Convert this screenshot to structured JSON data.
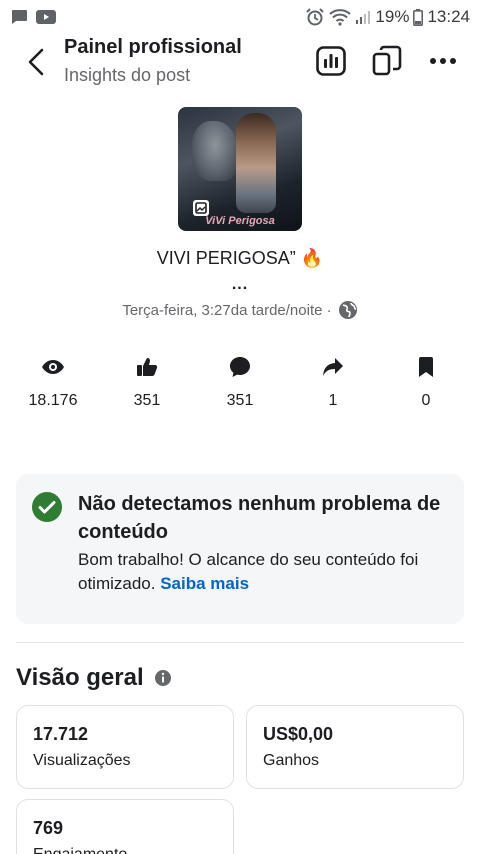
{
  "status_bar": {
    "battery": "19%",
    "time": "13:24"
  },
  "header": {
    "title": "Painel profissional",
    "subtitle": "Insights do post"
  },
  "post": {
    "thumbnail_caption": "ViVi Perigosa",
    "title": "VIVI PERIGOSA” 🔥",
    "more": "...",
    "timestamp": "Terça-feira, 3:27da tarde/noite ·"
  },
  "stats": [
    {
      "icon": "eye-icon",
      "value": "18.176"
    },
    {
      "icon": "thumbs-up-icon",
      "value": "351"
    },
    {
      "icon": "comment-icon",
      "value": "351"
    },
    {
      "icon": "share-icon",
      "value": "1"
    },
    {
      "icon": "bookmark-icon",
      "value": "0"
    }
  ],
  "notice": {
    "title": "Não detectamos nenhum problema de conteúdo",
    "body": "Bom trabalho! O alcance do seu conteúdo foi otimizado.",
    "link": "Saiba mais"
  },
  "overview": {
    "title": "Visão geral",
    "cards": [
      {
        "value": "17.712",
        "label": "Visualizações"
      },
      {
        "value": "US$0,00",
        "label": "Ganhos"
      },
      {
        "value": "769",
        "label": "Engajamento"
      }
    ]
  },
  "colors": {
    "accent_link": "#0064d1",
    "success_green": "#2e7d32",
    "text_primary": "#1c1e21",
    "text_secondary": "#65676b"
  }
}
